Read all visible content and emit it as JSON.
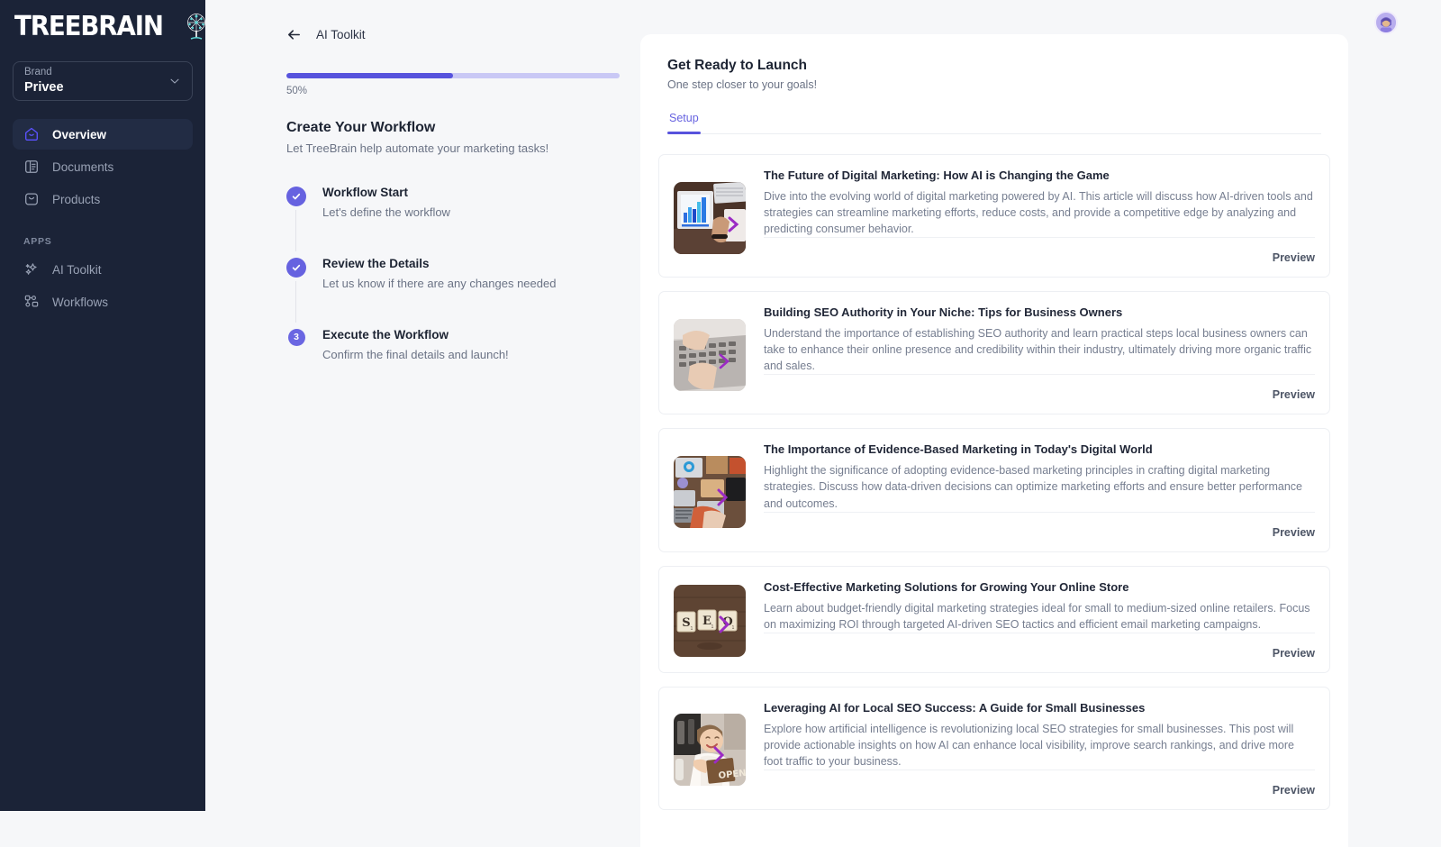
{
  "sidebar": {
    "logo_text": "TREEBRAIN",
    "logo_icon": "tree-network-icon",
    "brand": {
      "label": "Brand",
      "value": "Privee",
      "chevron_icon": "chevron-down-icon"
    },
    "items": [
      {
        "label": "Overview",
        "icon": "home-icon",
        "active": true
      },
      {
        "label": "Documents",
        "icon": "document-icon",
        "active": false
      },
      {
        "label": "Products",
        "icon": "bag-icon",
        "active": false
      }
    ],
    "section_label": "APPS",
    "app_items": [
      {
        "label": "AI Toolkit",
        "icon": "sparkles-icon"
      },
      {
        "label": "Workflows",
        "icon": "nodes-icon"
      }
    ]
  },
  "topbar": {
    "avatar_icon": "user-avatar"
  },
  "workflow": {
    "back_label": "AI Toolkit",
    "back_icon": "arrow-left-icon",
    "progress_percent": 50,
    "progress_label": "50%",
    "title": "Create Your Workflow",
    "subtitle": "Let TreeBrain help automate your marketing tasks!",
    "steps": [
      {
        "marker": "check",
        "title": "Workflow Start",
        "desc": "Let's define the workflow"
      },
      {
        "marker": "check",
        "title": "Review the Details",
        "desc": "Let us know if there are any changes needed"
      },
      {
        "marker": "3",
        "title": "Execute the Workflow",
        "desc": "Confirm the final details and launch!"
      }
    ]
  },
  "panel": {
    "title": "Get Ready to Launch",
    "subtitle": "One step closer to your goals!",
    "tabs": [
      {
        "label": "Setup",
        "active": true
      }
    ],
    "preview_label": "Preview",
    "cards": [
      {
        "title": "The Future of Digital Marketing: How AI is Changing the Game",
        "desc": "Dive into the evolving world of digital marketing powered by AI. This article will discuss how AI-driven tools and strategies can streamline marketing efforts, reduce costs, and provide a competitive edge by analyzing and predicting consumer behavior.",
        "thumb": "tablet-bar-chart-desk-photo",
        "preview_label": "Preview"
      },
      {
        "title": "Building SEO Authority in Your Niche: Tips for Business Owners",
        "desc": "Understand the importance of establishing SEO authority and learn practical steps local business owners can take to enhance their online presence and credibility within their industry, ultimately driving more organic traffic and sales.",
        "thumb": "hands-typing-laptop-photo",
        "preview_label": "Preview"
      },
      {
        "title": "The Importance of Evidence-Based Marketing in Today's Digital World",
        "desc": "Highlight the significance of adopting evidence-based marketing principles in crafting digital marketing strategies. Discuss how data-driven decisions can optimize marketing efforts and ensure better performance and outcomes.",
        "thumb": "overhead-desk-laptops-photo",
        "preview_label": "Preview"
      },
      {
        "title": "Cost-Effective Marketing Solutions for Growing Your Online Store",
        "desc": "Learn about budget-friendly digital marketing strategies ideal for small to medium-sized online retailers. Focus on maximizing ROI through targeted AI-driven SEO tactics and efficient email marketing campaigns.",
        "thumb": "seo-scrabble-tiles-photo",
        "preview_label": "Preview"
      },
      {
        "title": "Leveraging AI for Local SEO Success: A Guide for Small Businesses",
        "desc": "Explore how artificial intelligence is revolutionizing local SEO strategies for small businesses. This post will provide actionable insights on how AI can enhance local visibility, improve search rankings, and drive more foot traffic to your business.",
        "thumb": "shop-owner-open-sign-photo",
        "preview_label": "Preview"
      }
    ]
  },
  "colors": {
    "sidebar_bg": "#1b2337",
    "accent": "#5753dd",
    "accent_light": "#c9c8f5",
    "page_bg": "#f6f7f9",
    "panel_bg": "#ffffff"
  }
}
